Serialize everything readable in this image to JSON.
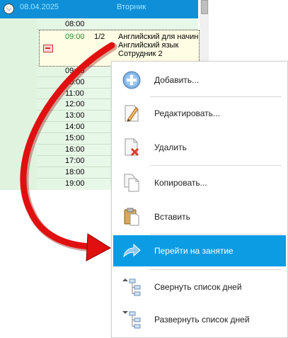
{
  "schedule": {
    "header": {
      "date": "08.04.2025",
      "day": "Вторник"
    },
    "times_before": [
      "08:00"
    ],
    "lesson": {
      "time": "09:00",
      "number": "1/2",
      "lines": [
        "Английский для начин",
        "Английский язык",
        "Сотрудник 2"
      ]
    },
    "times_after": [
      "09:45",
      "10:00",
      "11:00",
      "12:00",
      "13:00",
      "14:00",
      "15:00",
      "16:00",
      "17:00",
      "18:00",
      "19:00"
    ]
  },
  "context_menu": {
    "items": [
      {
        "label": "Добавить...",
        "icon": "add-circle-icon"
      },
      {
        "label": "Редактировать...",
        "icon": "edit-pencil-icon"
      },
      {
        "label": "Удалить",
        "icon": "delete-document-icon"
      },
      {
        "label": "Копировать...",
        "icon": "copy-documents-icon"
      },
      {
        "label": "Вставить",
        "icon": "paste-clipboard-icon"
      },
      {
        "label": "Перейти на занятие",
        "icon": "go-to-arrow-icon",
        "selected": true
      },
      {
        "label": "Свернуть список дней",
        "icon": "collapse-tree-icon"
      },
      {
        "label": "Развернуть список дней",
        "icon": "expand-tree-icon"
      }
    ]
  },
  "colors": {
    "header_bg": "#0f8fd7",
    "selection_bg": "#0b9ce4",
    "arrow": "#e01010",
    "lesson_bg": "#fffde4"
  }
}
